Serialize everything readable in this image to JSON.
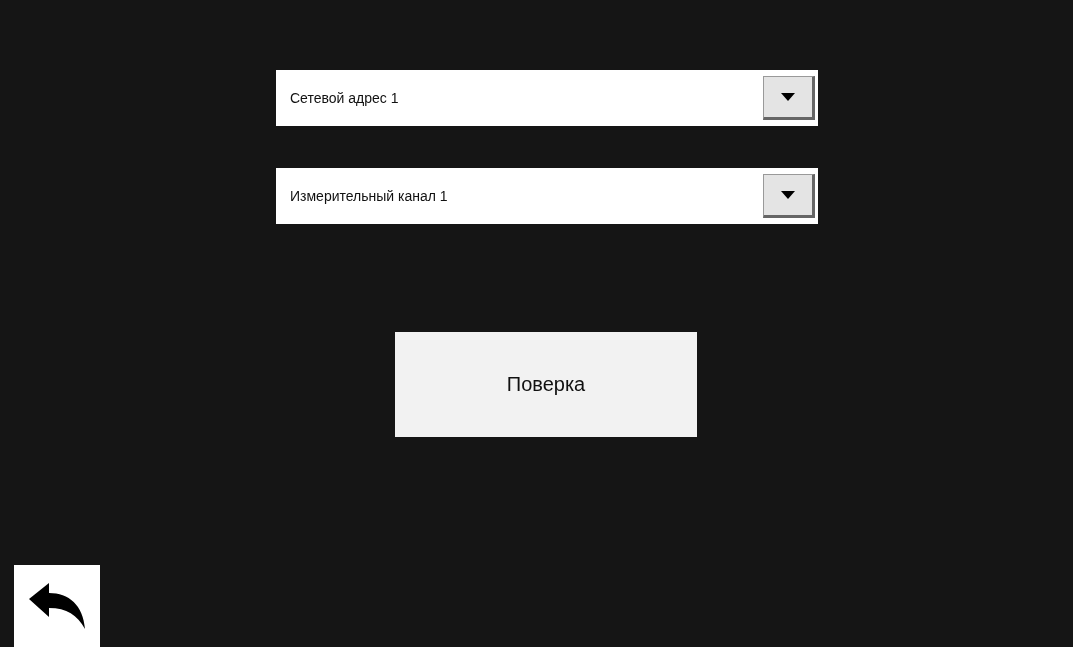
{
  "dropdowns": [
    {
      "value": "Сетевой адрес 1"
    },
    {
      "value": "Измерительный канал 1"
    }
  ],
  "action_button": {
    "label": "Поверка"
  }
}
